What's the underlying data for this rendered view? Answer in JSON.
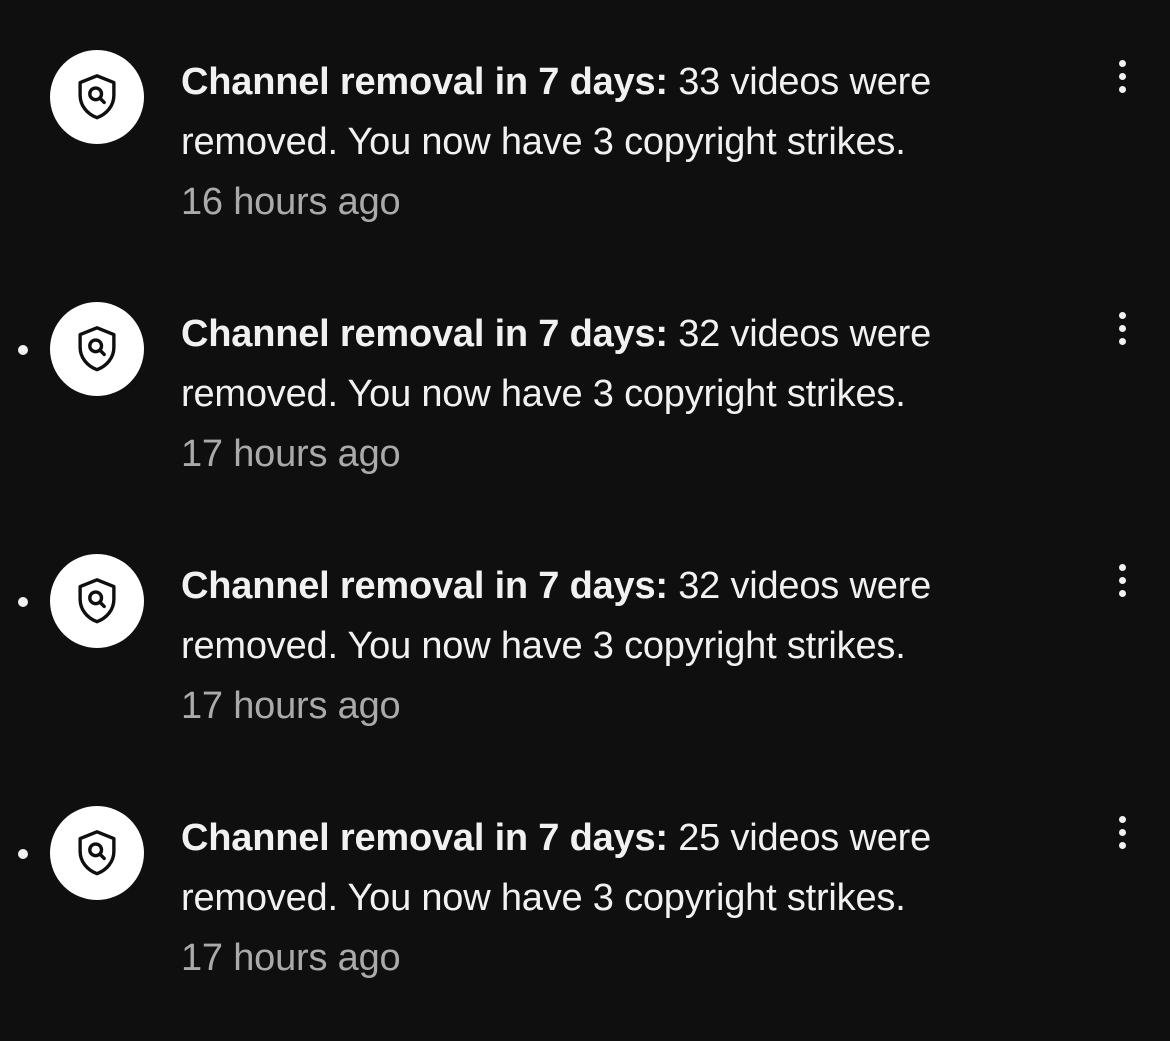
{
  "notifications": [
    {
      "unread": false,
      "icon": "shield-search-icon",
      "title": "Channel removal in 7 days:",
      "body": "33 videos were removed. You now have 3 copyright strikes.",
      "time": "16 hours ago"
    },
    {
      "unread": true,
      "icon": "shield-search-icon",
      "title": "Channel removal in 7 days:",
      "body": "32 videos were removed. You now have 3 copyright strikes.",
      "time": "17 hours ago"
    },
    {
      "unread": true,
      "icon": "shield-search-icon",
      "title": "Channel removal in 7 days:",
      "body": "32 videos were removed. You now have 3 copyright strikes.",
      "time": "17 hours ago"
    },
    {
      "unread": true,
      "icon": "shield-search-icon",
      "title": "Channel removal in 7 days:",
      "body": "25 videos were removed. You now have 3 copyright strikes.",
      "time": "17 hours ago"
    }
  ],
  "colors": {
    "background": "#0f0f0f",
    "primary_text": "#f1f1f1",
    "secondary_text": "#aaaaaa",
    "avatar_bg": "#ffffff"
  }
}
